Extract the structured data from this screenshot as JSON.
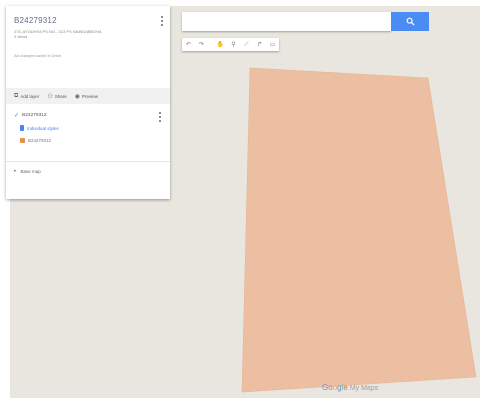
{
  "map": {
    "polygon_color": "#ecbfa3",
    "canvas_color": "#e8e6df"
  },
  "panel": {
    "title": "B24279312",
    "subtitle": "275, AYODHYA PS NO.- 313 PS NAINDABEDHA",
    "views": "2 views",
    "saved_status": "All changes saved in Drive",
    "actions": {
      "add_layer": "Add layer",
      "share": "Share",
      "preview": "Preview"
    },
    "layer": {
      "name": "B24279312",
      "styles_label": "Individual styles",
      "feature_name": "B24279312",
      "feature_color": "#e9914a"
    },
    "base_map_label": "Base map"
  },
  "search": {
    "value": "",
    "placeholder": "",
    "button_color": "#4b8bf4"
  },
  "toolbar": {
    "tools": [
      "undo-icon",
      "redo-icon",
      "pan-hand-icon",
      "add-marker-icon",
      "draw-line-icon",
      "directions-icon",
      "measure-ruler-icon"
    ]
  },
  "footer": {
    "brand_g": "G",
    "brand_o1": "o",
    "brand_o2": "o",
    "brand_g2": "g",
    "brand_l": "l",
    "brand_e": "e",
    "product": "My Maps"
  }
}
